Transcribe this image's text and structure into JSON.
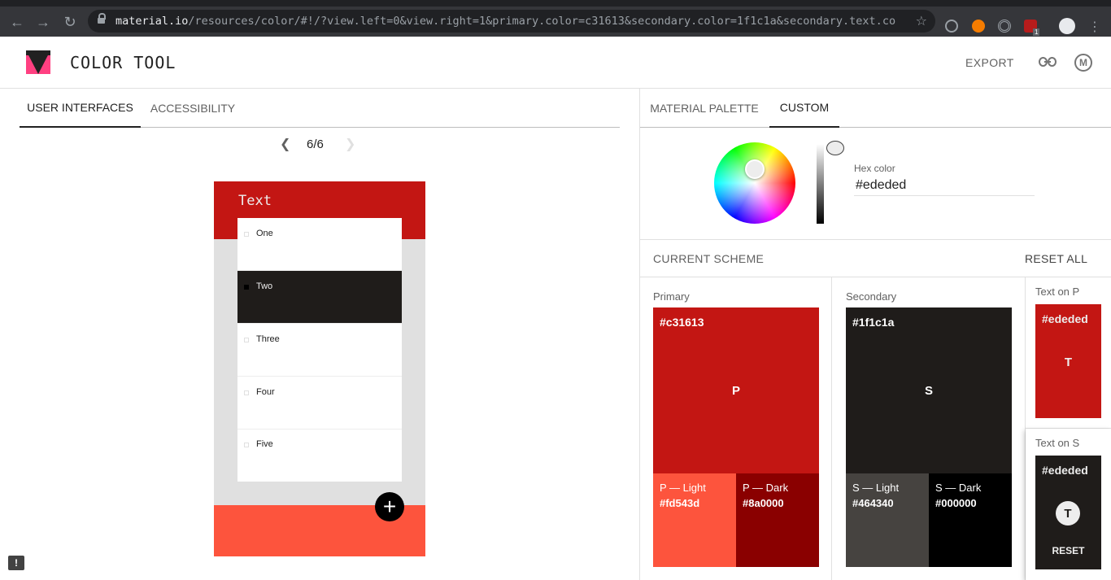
{
  "browser": {
    "url_host": "material.io",
    "url_path": "/resources/color/#!/?view.left=0&view.right=1&primary.color=c31613&secondary.color=1f1c1a&secondary.text.col…",
    "extension_badge": "1"
  },
  "header": {
    "title": "COLOR TOOL",
    "export_label": "EXPORT",
    "link_icon": "link-icon",
    "material_icon": "M"
  },
  "left_tabs": [
    {
      "label": "USER INTERFACES",
      "active": true
    },
    {
      "label": "ACCESSIBILITY",
      "active": false
    }
  ],
  "pager": {
    "count": "6/6"
  },
  "phone": {
    "title": "Text",
    "items": [
      "One",
      "Two",
      "Three",
      "Four",
      "Five"
    ],
    "selected_index": 1,
    "fab_label": "+"
  },
  "right_tabs": [
    {
      "label": "MATERIAL PALETTE",
      "active": false
    },
    {
      "label": "CUSTOM",
      "active": true
    }
  ],
  "picker": {
    "hex_label": "Hex color",
    "hex_value": "#ededed"
  },
  "scheme": {
    "title": "CURRENT SCHEME",
    "reset_all": "RESET ALL",
    "primary": {
      "label": "Primary",
      "hex": "#c31613",
      "letter": "P",
      "light_name": "P — Light",
      "light_hex": "#fd543d",
      "dark_name": "P — Dark",
      "dark_hex": "#8a0000"
    },
    "secondary": {
      "label": "Secondary",
      "hex": "#1f1c1a",
      "letter": "S",
      "light_name": "S — Light",
      "light_hex": "#464340",
      "dark_name": "S — Dark",
      "dark_hex": "#000000"
    },
    "text_on_p": {
      "label": "Text on P",
      "hex": "#ededed",
      "letter": "T"
    },
    "text_on_s": {
      "label": "Text on S",
      "hex": "#ededed",
      "letter": "T",
      "reset": "RESET"
    }
  },
  "colors": {
    "primary": "#c31613",
    "primary_light": "#fd543d",
    "primary_dark": "#8a0000",
    "secondary": "#1f1c1a",
    "secondary_light": "#464340",
    "secondary_dark": "#000000",
    "text": "#ededed"
  }
}
